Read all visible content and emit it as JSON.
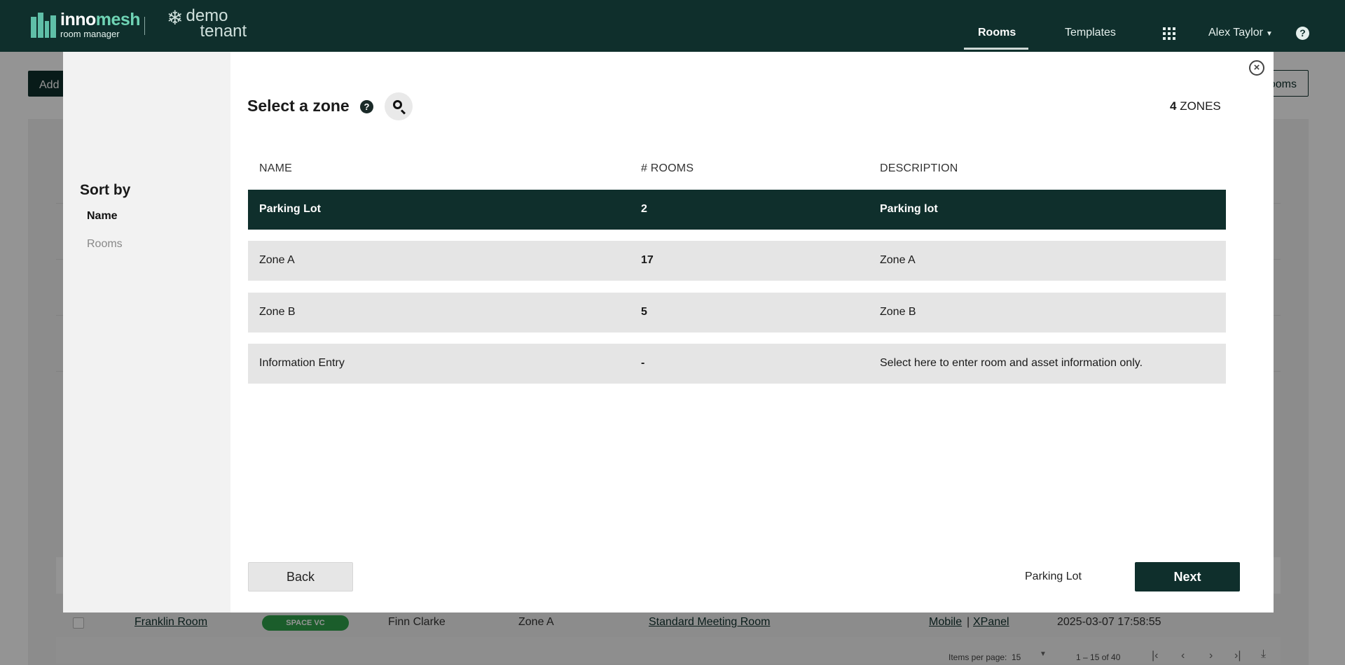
{
  "header": {
    "brand_inno": "inno",
    "brand_mesh": "mesh",
    "brand_sub": "room manager",
    "tenant_line1": "demo",
    "tenant_line2": "tenant",
    "nav": {
      "rooms": "Rooms",
      "templates": "Templates",
      "user": "Alex Taylor"
    },
    "help_glyph": "?"
  },
  "background": {
    "add_button": "Add",
    "rooms_button": "ooms",
    "row": {
      "name": "Franklin Room",
      "badge": "SPACE VC",
      "owner": "Finn Clarke",
      "zone": "Zone A",
      "template": "Standard Meeting Room",
      "link_mobile": "Mobile",
      "link_sep": "|",
      "link_xpanel": "XPanel",
      "timestamp": "2025-03-07 17:58:55"
    },
    "pager": {
      "items_label": "Items per page:",
      "items_value": "15",
      "range": "1 – 15 of 40"
    }
  },
  "modal": {
    "sort_title": "Sort by",
    "sort_options": [
      "Name",
      "Rooms"
    ],
    "title": "Select a zone",
    "count_value": "4",
    "count_label": "ZONES",
    "columns": [
      "NAME",
      "# ROOMS",
      "DESCRIPTION"
    ],
    "rows": [
      {
        "name": "Parking Lot",
        "rooms": "2",
        "description": "Parking lot",
        "selected": true
      },
      {
        "name": "Zone A",
        "rooms": "17",
        "description": "Zone A",
        "selected": false
      },
      {
        "name": "Zone B",
        "rooms": "5",
        "description": "Zone B",
        "selected": false
      },
      {
        "name": "Information Entry",
        "rooms": "-",
        "description": "Select here to enter room and asset information only.",
        "selected": false
      }
    ],
    "back_label": "Back",
    "selected_label": "Parking Lot",
    "next_label": "Next"
  },
  "colors": {
    "primary": "#0f2f2c",
    "accent": "#6fd4b5",
    "row_bg": "#e5e5e5",
    "badge_green": "#2fa04a"
  },
  "icons": [
    "help-icon",
    "search-icon",
    "close-icon",
    "apps-grid-icon",
    "caret-down-icon",
    "snowflake-icon"
  ]
}
